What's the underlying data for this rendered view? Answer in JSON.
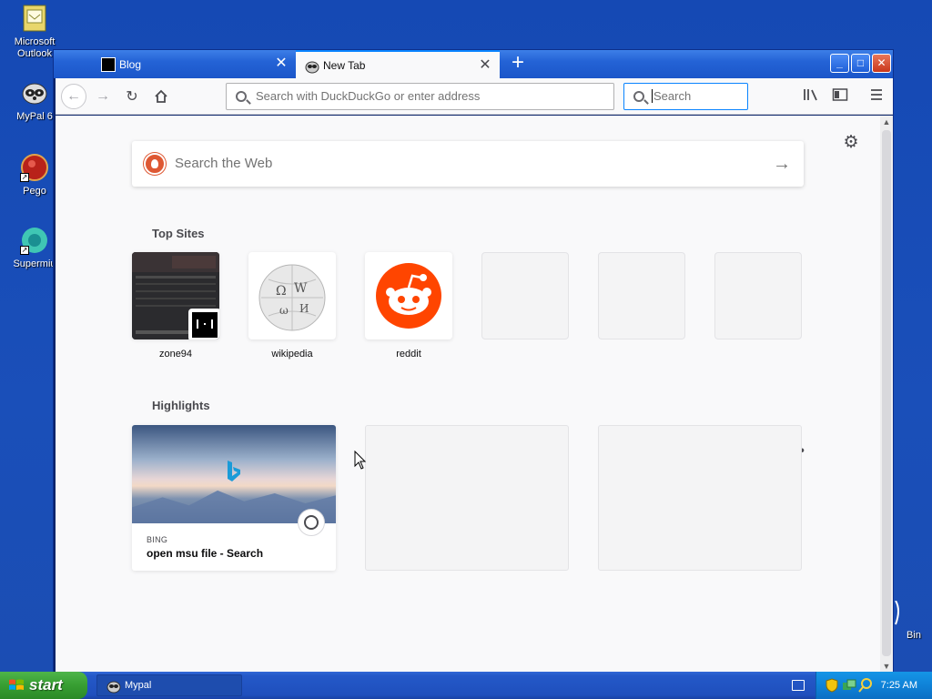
{
  "desktop": {
    "icons": [
      {
        "label": "Microsoft Outlook",
        "name": "outlook"
      },
      {
        "label": "MyPal 6",
        "name": "mypal"
      },
      {
        "label": "Pego",
        "name": "pego"
      },
      {
        "label": "Supermiu",
        "name": "supermium"
      },
      {
        "label": "Bin",
        "name": "recycle-bin"
      }
    ]
  },
  "browser": {
    "tabs": [
      {
        "label": "Blog",
        "active": false
      },
      {
        "label": "New Tab",
        "active": true
      }
    ],
    "url_placeholder": "Search with DuckDuckGo or enter address",
    "search_placeholder": "Search"
  },
  "newtab": {
    "web_search_placeholder": "Search the Web",
    "top_sites_title": "Top Sites",
    "top_sites": [
      {
        "label": "zone94"
      },
      {
        "label": "wikipedia"
      },
      {
        "label": "reddit"
      },
      {
        "label": ""
      },
      {
        "label": ""
      },
      {
        "label": ""
      }
    ],
    "highlights_title": "Highlights",
    "highlights": [
      {
        "source": "BING",
        "title": "open msu file - Search"
      }
    ]
  },
  "taskbar": {
    "start_label": "start",
    "task_label": "Mypal",
    "clock": "7:25 AM"
  },
  "colors": {
    "accent": "#0a84ff",
    "reddit": "#ff4500",
    "xp_blue": "#245edb"
  }
}
